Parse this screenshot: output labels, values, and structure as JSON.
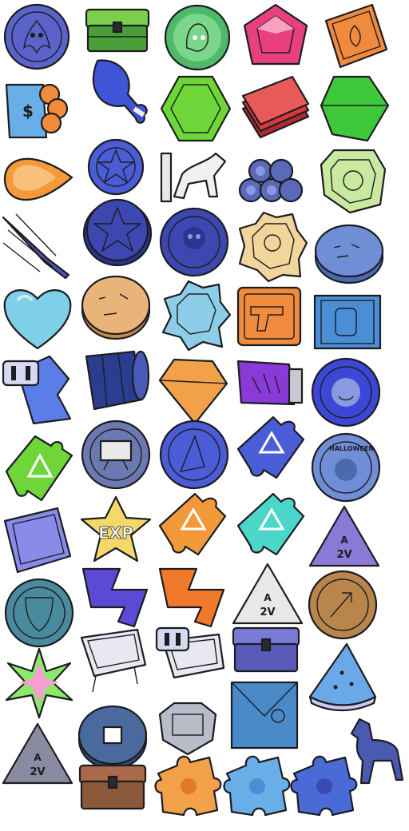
{
  "sheet": {
    "background": "#ffffff",
    "columns": 5,
    "rows": 11
  },
  "icons": [
    {
      "icon": "dragon-coin-icon",
      "color": "#5a63c9"
    },
    {
      "icon": "green-chest-icon",
      "color": "#5aa53a"
    },
    {
      "icon": "spirit-orb-icon",
      "color": "#4fb86a"
    },
    {
      "icon": "pink-gem-icon",
      "color": "#e8407e"
    },
    {
      "icon": "lotus-ticket-icon",
      "color": "#f08a3c"
    },
    {
      "icon": "money-bag-icon",
      "color": "#f28c3a"
    },
    {
      "icon": "blue-drumstick-icon",
      "color": "#3d55d6"
    },
    {
      "icon": "green-hex-gem-icon",
      "color": "#6fd63a"
    },
    {
      "icon": "red-cash-stack-icon",
      "color": "#d83a3a"
    },
    {
      "icon": "green-emerald-icon",
      "color": "#3fc93a"
    },
    {
      "icon": "orange-drop-gem-icon",
      "color": "#f59a3a"
    },
    {
      "icon": "star-emblem-icon",
      "color": "#4a5cd6"
    },
    {
      "icon": "horse-statue-icon",
      "color": "#e8e8e8"
    },
    {
      "icon": "log-pile-icon",
      "color": "#5b6ab8"
    },
    {
      "icon": "green-badge-icon",
      "color": "#c9e8a0"
    },
    {
      "icon": "lavender-bundle-icon",
      "color": "#4a55b8"
    },
    {
      "icon": "star-coin-icon",
      "color": "#3d47b0"
    },
    {
      "icon": "skull-coin-icon",
      "color": "#3d47b0"
    },
    {
      "icon": "gold-badge-icon",
      "color": "#f2d59a"
    },
    {
      "icon": "stone-coin-icon",
      "color": "#6f8ed6"
    },
    {
      "icon": "heart-icon",
      "color": "#7ecfe8"
    },
    {
      "icon": "cookie-coin-icon",
      "color": "#e8b47a"
    },
    {
      "icon": "blue-badge-icon",
      "color": "#8ecde8"
    },
    {
      "icon": "pistol-card-icon",
      "color": "#f08a3c"
    },
    {
      "icon": "fist-card-icon",
      "color": "#4a8ed6"
    },
    {
      "icon": "bound-crystal-icon",
      "color": "#5a7de8"
    },
    {
      "icon": "barrel-icon",
      "color": "#2a3d8e"
    },
    {
      "icon": "orange-diamond-icon",
      "color": "#f2a04a"
    },
    {
      "icon": "purple-canister-icon",
      "color": "#8a3ad6"
    },
    {
      "icon": "blue-smile-coin-icon",
      "color": "#3d47d6"
    },
    {
      "icon": "green-puzzle-icon",
      "color": "#6fd63a"
    },
    {
      "icon": "monitor-coin-icon",
      "color": "#6a7ab0"
    },
    {
      "icon": "witch-coin-icon",
      "color": "#4a5cd6"
    },
    {
      "icon": "blue-puzzle-icon",
      "color": "#4a5cd6"
    },
    {
      "icon": "halloween-coin-icon",
      "color": "#6f8ed6"
    },
    {
      "icon": "green-card-icon",
      "color": "#8a8ae8"
    },
    {
      "icon": "exp-star-icon",
      "color": "#f5d86a"
    },
    {
      "icon": "orange-puzzle-icon",
      "color": "#f29a3a"
    },
    {
      "icon": "cyan-puzzle-icon",
      "color": "#4ad6c9"
    },
    {
      "icon": "purple-triangle-icon",
      "color": "#8a7ad6"
    },
    {
      "icon": "shield-coin-icon",
      "color": "#4a8a9e"
    },
    {
      "icon": "purple-bolt-icon",
      "color": "#5a4ad6"
    },
    {
      "icon": "orange-bolt-icon",
      "color": "#f07a2a"
    },
    {
      "icon": "white-triangle-icon",
      "color": "#e8e8e8"
    },
    {
      "icon": "bronze-arrow-coin-icon",
      "color": "#b8864a"
    },
    {
      "icon": "rainbow-star-icon",
      "color": "#8ae86a"
    },
    {
      "icon": "blue-bucket-icon",
      "color": "#3d55d6"
    },
    {
      "icon": "bound-bucket-icon",
      "color": "#3d55d6"
    },
    {
      "icon": "purple-chest-icon",
      "color": "#5a5ab8"
    },
    {
      "icon": "watermelon-slice-icon",
      "color": "#6aa8e8"
    },
    {
      "icon": "gray-triangle-icon",
      "color": "#8a8aa0"
    },
    {
      "icon": "square-hole-coin-icon",
      "color": "#4a6a9e"
    },
    {
      "icon": "silver-crest-icon",
      "color": "#b8bcc9"
    },
    {
      "icon": "blue-envelope-icon",
      "color": "#4a8ac9"
    },
    {
      "icon": "horse-figure-icon",
      "color": "#4a5ab0"
    },
    {
      "icon": "brown-chest-icon",
      "color": "#8a5a3a"
    },
    {
      "icon": "orange-puzzle-piece-icon",
      "color": "#f2a04a"
    },
    {
      "icon": "light-blue-puzzle-piece-icon",
      "color": "#6aaee8"
    },
    {
      "icon": "blue-puzzle-piece-icon",
      "color": "#4a6ad6"
    }
  ],
  "labels": {
    "halloween": "HALLOWEEN",
    "exp": "EXP",
    "triangle_a": "A",
    "triangle_2v": "2V"
  }
}
